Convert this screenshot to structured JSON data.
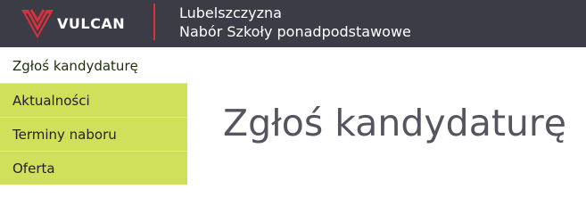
{
  "header": {
    "logo_text": "VULCAN",
    "title_line1": "Lubelszczyzna",
    "title_line2": "Nabór Szkoły ponadpodstawowe",
    "colors": {
      "bar": "#3c3c46",
      "accent": "#d6323c"
    }
  },
  "sidebar": {
    "items": [
      {
        "label": "Zgłoś kandydaturę",
        "active": true
      },
      {
        "label": "Aktualności",
        "active": false
      },
      {
        "label": "Terminy naboru",
        "active": false
      },
      {
        "label": "Oferta",
        "active": false
      }
    ],
    "colors": {
      "item_bg": "#cfe05b"
    }
  },
  "main": {
    "title": "Zgłoś kandydaturę"
  }
}
